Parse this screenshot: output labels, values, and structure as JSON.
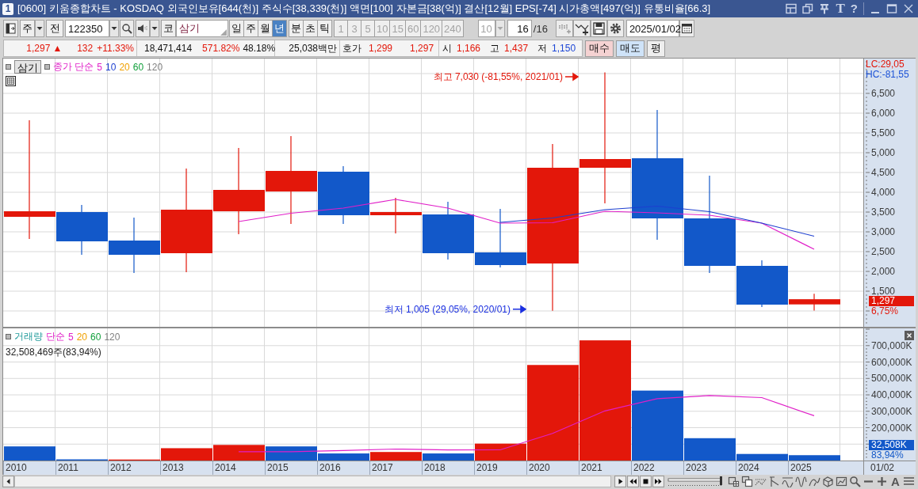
{
  "window": {
    "number": "1",
    "title": "[0600] 키움종합차트 - KOSDAQ 외국인보유[644(천)] 주식수[38,339(천)] 액면[100] 자본금[38(억)] 결산[12월] EPS[-74] 시가총액[497(억)] 유통비율[66.3]",
    "font_button": "T",
    "help_button": "?"
  },
  "toolbar": {
    "market_select": "주",
    "mode_button": "전",
    "code": "122350",
    "market_button": "코",
    "stock_name": "삼기",
    "periods": [
      {
        "label": "일",
        "selected": false
      },
      {
        "label": "주",
        "selected": false
      },
      {
        "label": "월",
        "selected": false
      },
      {
        "label": "년",
        "selected": true
      }
    ],
    "time_periods": [
      {
        "label": "분",
        "selected": false
      },
      {
        "label": "초",
        "selected": false
      },
      {
        "label": "틱",
        "selected": false
      }
    ],
    "intervals": [
      {
        "label": "1",
        "disabled": true
      },
      {
        "label": "3",
        "disabled": true
      },
      {
        "label": "5",
        "disabled": true
      },
      {
        "label": "10",
        "disabled": true
      },
      {
        "label": "15",
        "disabled": true
      },
      {
        "label": "60",
        "disabled": true
      },
      {
        "label": "120",
        "disabled": true
      },
      {
        "label": "240",
        "disabled": true
      }
    ],
    "interval_select": {
      "value": "10",
      "disabled": true
    },
    "count": "16",
    "count_total": "/16",
    "date": "2025/01/02"
  },
  "quote": {
    "price": {
      "value": "1,297",
      "mark": "▲",
      "rising": true
    },
    "change": {
      "value": "132",
      "rate": "+11.33%",
      "rising": true
    },
    "volume": "18,471,414",
    "volume_rate": {
      "value": "571.82%",
      "rising": true
    },
    "turnover": "48.18%",
    "amount": "25,038백만",
    "hoga": {
      "label": "호가",
      "ask": {
        "value": "1,299",
        "rising": true
      },
      "bid": {
        "value": "1,297",
        "rising": true
      }
    },
    "ohl": [
      {
        "label": "시",
        "value": "1,166",
        "rising": true
      },
      {
        "label": "고",
        "value": "1,437",
        "rising": true
      },
      {
        "label": "저",
        "value": "1,150",
        "rising": false
      }
    ],
    "buttons": [
      {
        "label": "매수",
        "kind": "buy"
      },
      {
        "label": "매도",
        "kind": "sell"
      },
      {
        "label": "평",
        "kind": "plain"
      }
    ]
  },
  "price_pane": {
    "stock_button": "삼기",
    "ma_label": "종가 단순",
    "ma_periods": [
      {
        "label": "5",
        "color": "#e01fc8"
      },
      {
        "label": "10",
        "color": "#1d3fd0"
      },
      {
        "label": "20",
        "color": "#f0a000"
      },
      {
        "label": "60",
        "color": "#12a03c"
      },
      {
        "label": "120",
        "color": "#808080"
      }
    ],
    "lc": "LC:29,05",
    "hc": "HC:-81,55",
    "last_price": "1,297",
    "last_rate": "6,75%",
    "chart_data": [
      {
        "type": "candlestick",
        "categories": [
          null,
          null,
          null,
          null,
          null,
          null,
          null,
          null,
          null,
          null,
          null,
          null,
          null,
          null,
          null,
          null
        ],
        "ohlc": [
          [
            3380,
            5820,
            2820,
            3520
          ],
          [
            3500,
            3680,
            2420,
            2760
          ],
          [
            2780,
            3360,
            1960,
            2420
          ],
          [
            2460,
            4600,
            1980,
            3560
          ],
          [
            3520,
            5120,
            2940,
            4060
          ],
          [
            4020,
            5420,
            3200,
            4540
          ],
          [
            4520,
            4660,
            3200,
            3420
          ],
          [
            3420,
            3860,
            2960,
            3500
          ],
          [
            3440,
            3760,
            2300,
            2460
          ],
          [
            2480,
            3580,
            2100,
            2160
          ],
          [
            2200,
            5220,
            1005,
            4620
          ],
          [
            4620,
            7030,
            3720,
            4840
          ],
          [
            4860,
            6080,
            2800,
            3340
          ],
          [
            3340,
            4420,
            1960,
            2140
          ],
          [
            2140,
            2280,
            1100,
            1160
          ],
          [
            1166,
            1437,
            1010,
            1297
          ]
        ],
        "series": [
          {
            "type": "line",
            "color": "#e01fc8",
            "values": [
              null,
              null,
              null,
              null,
              3260,
              3470,
              3600,
              3820,
              3600,
              3220,
              3230,
              3520,
              3480,
              3420,
              3220,
              2560
            ]
          },
          {
            "type": "line",
            "color": "#1d3fd0",
            "values": [
              null,
              null,
              null,
              null,
              null,
              null,
              null,
              null,
              null,
              3240,
              3350,
              3560,
              3650,
              3510,
              3220,
              2890
            ]
          }
        ],
        "ylim": [
          600,
          7380
        ],
        "yticks": [
          {
            "value": 1500,
            "label": "1,500"
          },
          {
            "value": 2000,
            "label": "2,000"
          },
          {
            "value": 2500,
            "label": "2,500"
          },
          {
            "value": 3000,
            "label": "3,000"
          },
          {
            "value": 3500,
            "label": "3,500"
          },
          {
            "value": 4000,
            "label": "4,000"
          },
          {
            "value": 4500,
            "label": "4,500"
          },
          {
            "value": 5000,
            "label": "5,000"
          },
          {
            "value": 5500,
            "label": "5,500"
          },
          {
            "value": 6000,
            "label": "6,000"
          },
          {
            "value": 6500,
            "label": "6,500"
          }
        ],
        "grid": true,
        "annotations": [
          "최고 7,030 (-81,55%, 2021/01)",
          "최저 1,005 (29,05%, 2020/01)"
        ]
      }
    ]
  },
  "volume_pane": {
    "label": "거래량",
    "ma_label": "단순",
    "ma_periods": [
      {
        "label": "5",
        "color": "#e01fc8"
      },
      {
        "label": "20",
        "color": "#f0a000"
      },
      {
        "label": "60",
        "color": "#12a03c"
      },
      {
        "label": "120",
        "color": "#808080"
      }
    ],
    "summary": "32,508,469주(83,94%)",
    "last_volume": "32,508K",
    "last_rate": "83,94%",
    "date_label": "01/02",
    "chart_data": [
      {
        "type": "bar",
        "categories": [
          "2010",
          "2011",
          "2012",
          "2013",
          "2014",
          "2015",
          "2016",
          "2017",
          "2018",
          "2019",
          "2020",
          "2021",
          "2022",
          "2023",
          "2024",
          "2025"
        ],
        "series": [
          {
            "type": "bar",
            "values": [
              86000,
              7000,
              6000,
              75000,
              95000,
              86000,
              43000,
              52000,
              43000,
              103000,
              582000,
              732000,
              426000,
              136000,
              40000,
              32508
            ],
            "colors": [
              "#1258c9",
              "#1258c9",
              "#e3170a",
              "#e3170a",
              "#e3170a",
              "#1258c9",
              "#1258c9",
              "#e3170a",
              "#1258c9",
              "#e3170a",
              "#e3170a",
              "#e3170a",
              "#1258c9",
              "#1258c9",
              "#1258c9",
              "#1258c9"
            ]
          },
          {
            "type": "line",
            "color": "#e01fc8",
            "values": [
              null,
              null,
              null,
              null,
              54000,
              54000,
              61000,
              70000,
              64000,
              65000,
              165000,
              302000,
              377000,
              396000,
              383000,
              273000
            ]
          }
        ],
        "ylim": [
          0,
          805000
        ],
        "yticks": [
          {
            "value": 200000,
            "label": "200,000K"
          },
          {
            "value": 300000,
            "label": "300,000K"
          },
          {
            "value": 400000,
            "label": "400,000K"
          },
          {
            "value": 500000,
            "label": "500,000K"
          },
          {
            "value": 600000,
            "label": "600,000K"
          },
          {
            "value": 700000,
            "label": "700,000K"
          }
        ],
        "grid": true
      }
    ]
  },
  "navigator": {
    "zoom": {
      "level": 1
    },
    "font_button": "A"
  }
}
